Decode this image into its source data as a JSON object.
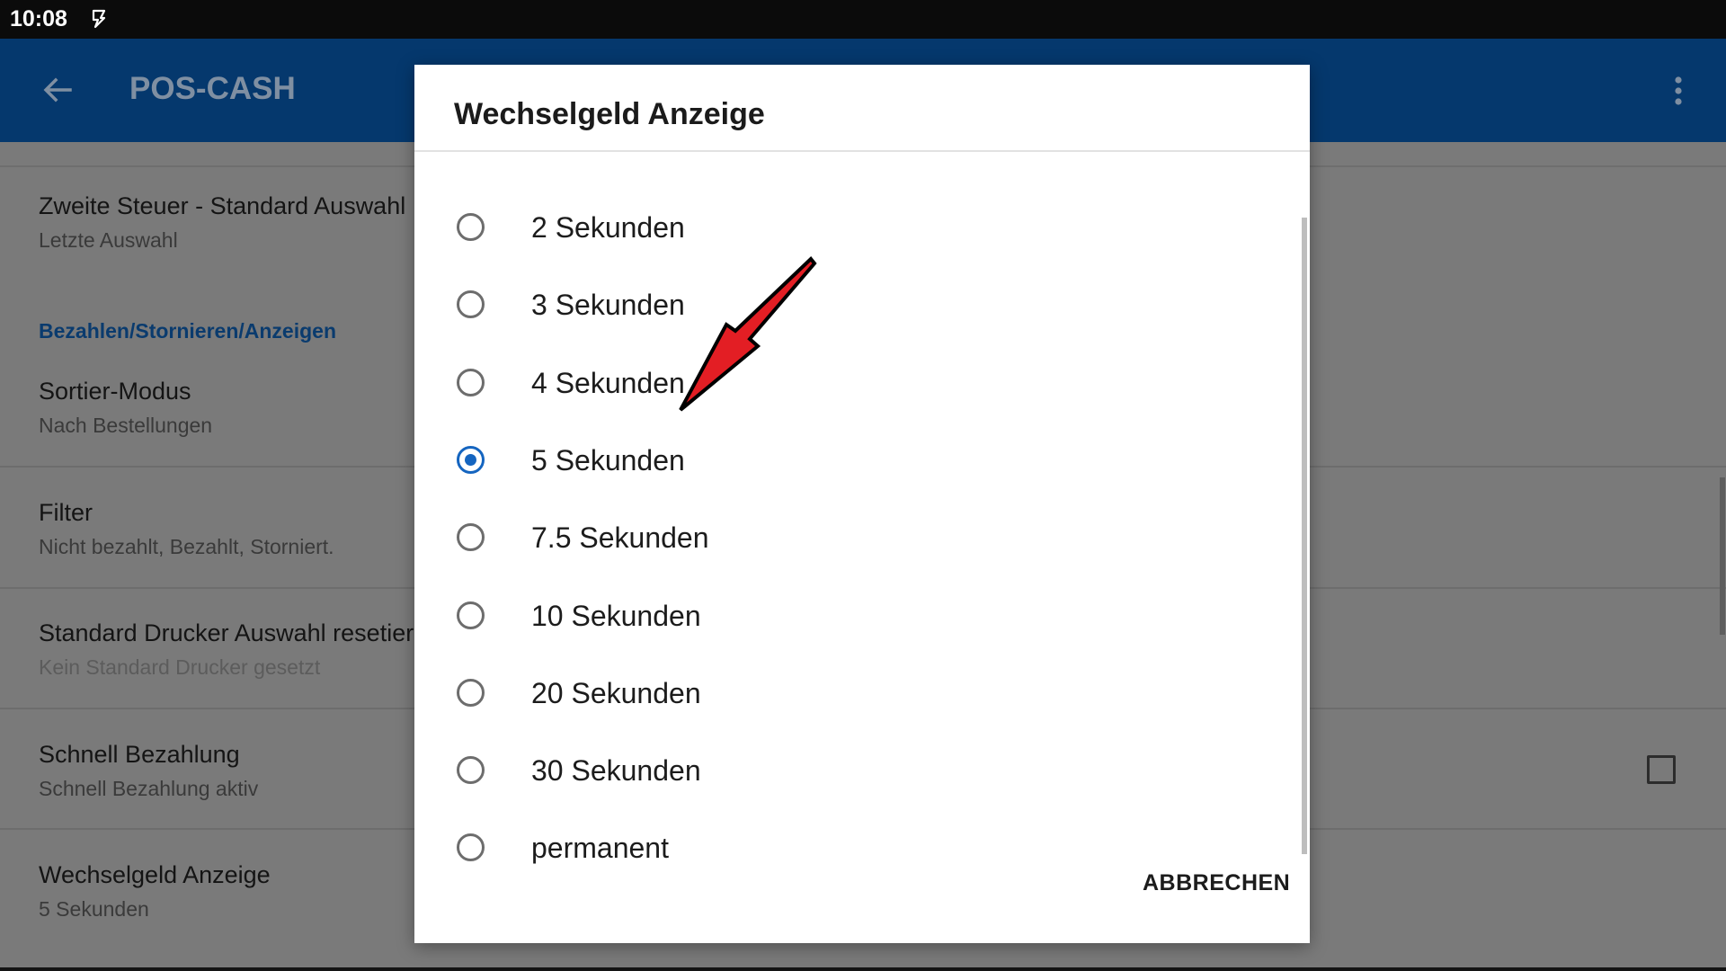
{
  "status_bar": {
    "time": "10:08"
  },
  "app_bar": {
    "title": "POS-CASH",
    "back_icon": "arrow-back-icon",
    "menu_icon": "more-vert-icon"
  },
  "settings": {
    "items": [
      {
        "title": "Zweite Steuer - Standard Auswahl",
        "summary": "Letzte Auswahl"
      },
      {
        "title": "Sortier-Modus",
        "summary": "Nach Bestellungen"
      },
      {
        "title": "Filter",
        "summary": "Nicht bezahlt, Bezahlt, Storniert."
      },
      {
        "title": "Standard Drucker Auswahl resetieren",
        "summary": "Kein Standard Drucker gesetzt"
      },
      {
        "title": "Schnell Bezahlung",
        "summary": "Schnell Bezahlung aktiv"
      },
      {
        "title": "Wechselgeld Anzeige",
        "summary": "5 Sekunden"
      }
    ],
    "category": "Bezahlen/Stornieren/Anzeigen",
    "schnell_checked": false
  },
  "dialog": {
    "title": "Wechselgeld Anzeige",
    "options": [
      "2 Sekunden",
      "3 Sekunden",
      "4 Sekunden",
      "5 Sekunden",
      "7.5 Sekunden",
      "10 Sekunden",
      "20 Sekunden",
      "30 Sekunden",
      "permanent"
    ],
    "selected": "5 Sekunden",
    "cancel_label": "ABBRECHEN"
  },
  "colors": {
    "app_bar": "#05386d",
    "accent": "#1565c0",
    "annotation_arrow": "#e31e24"
  }
}
